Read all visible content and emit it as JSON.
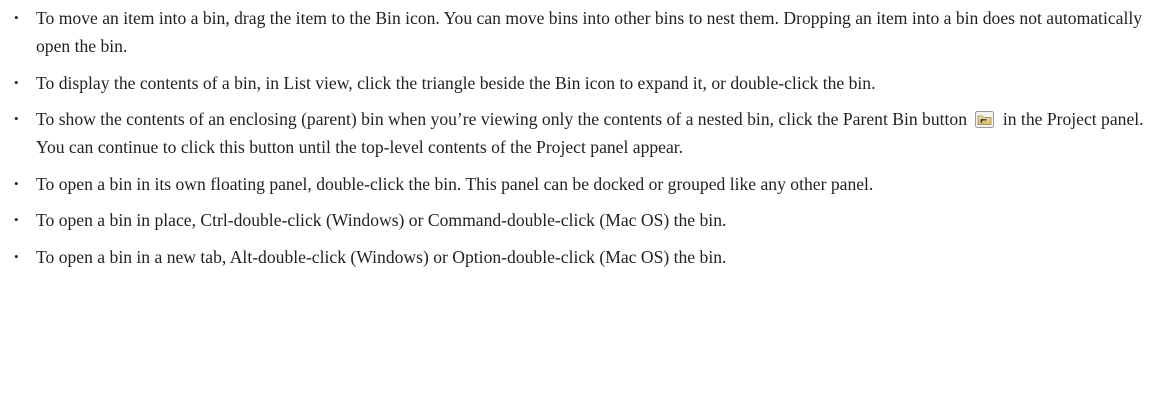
{
  "bullet_char": "•",
  "items": [
    {
      "text": "To move an item into a bin, drag the item to the Bin icon. You can move bins into other bins to nest them. Dropping an item into a bin does not automatically open the bin."
    },
    {
      "text": "To display the contents of a bin, in List view, click the triangle beside the Bin icon to expand it, or double-click the bin."
    },
    {
      "text_before": "To show the contents of an enclosing (parent) bin when you’re viewing only the contents of a nested bin, click the Parent Bin button",
      "icon": "parent-bin-icon",
      "text_after": "in the Project panel. You can continue to click this button until the top-level contents of the Project panel appear."
    },
    {
      "text": "To open a bin in its own floating panel, double-click the bin. This panel can be docked or grouped like any other panel."
    },
    {
      "text": "To open a bin in place, Ctrl-double-click (Windows) or Command-double-click (Mac OS) the bin."
    },
    {
      "text": "To open a bin in a new tab, Alt-double-click (Windows) or Option-double-click (Mac OS) the bin."
    }
  ]
}
